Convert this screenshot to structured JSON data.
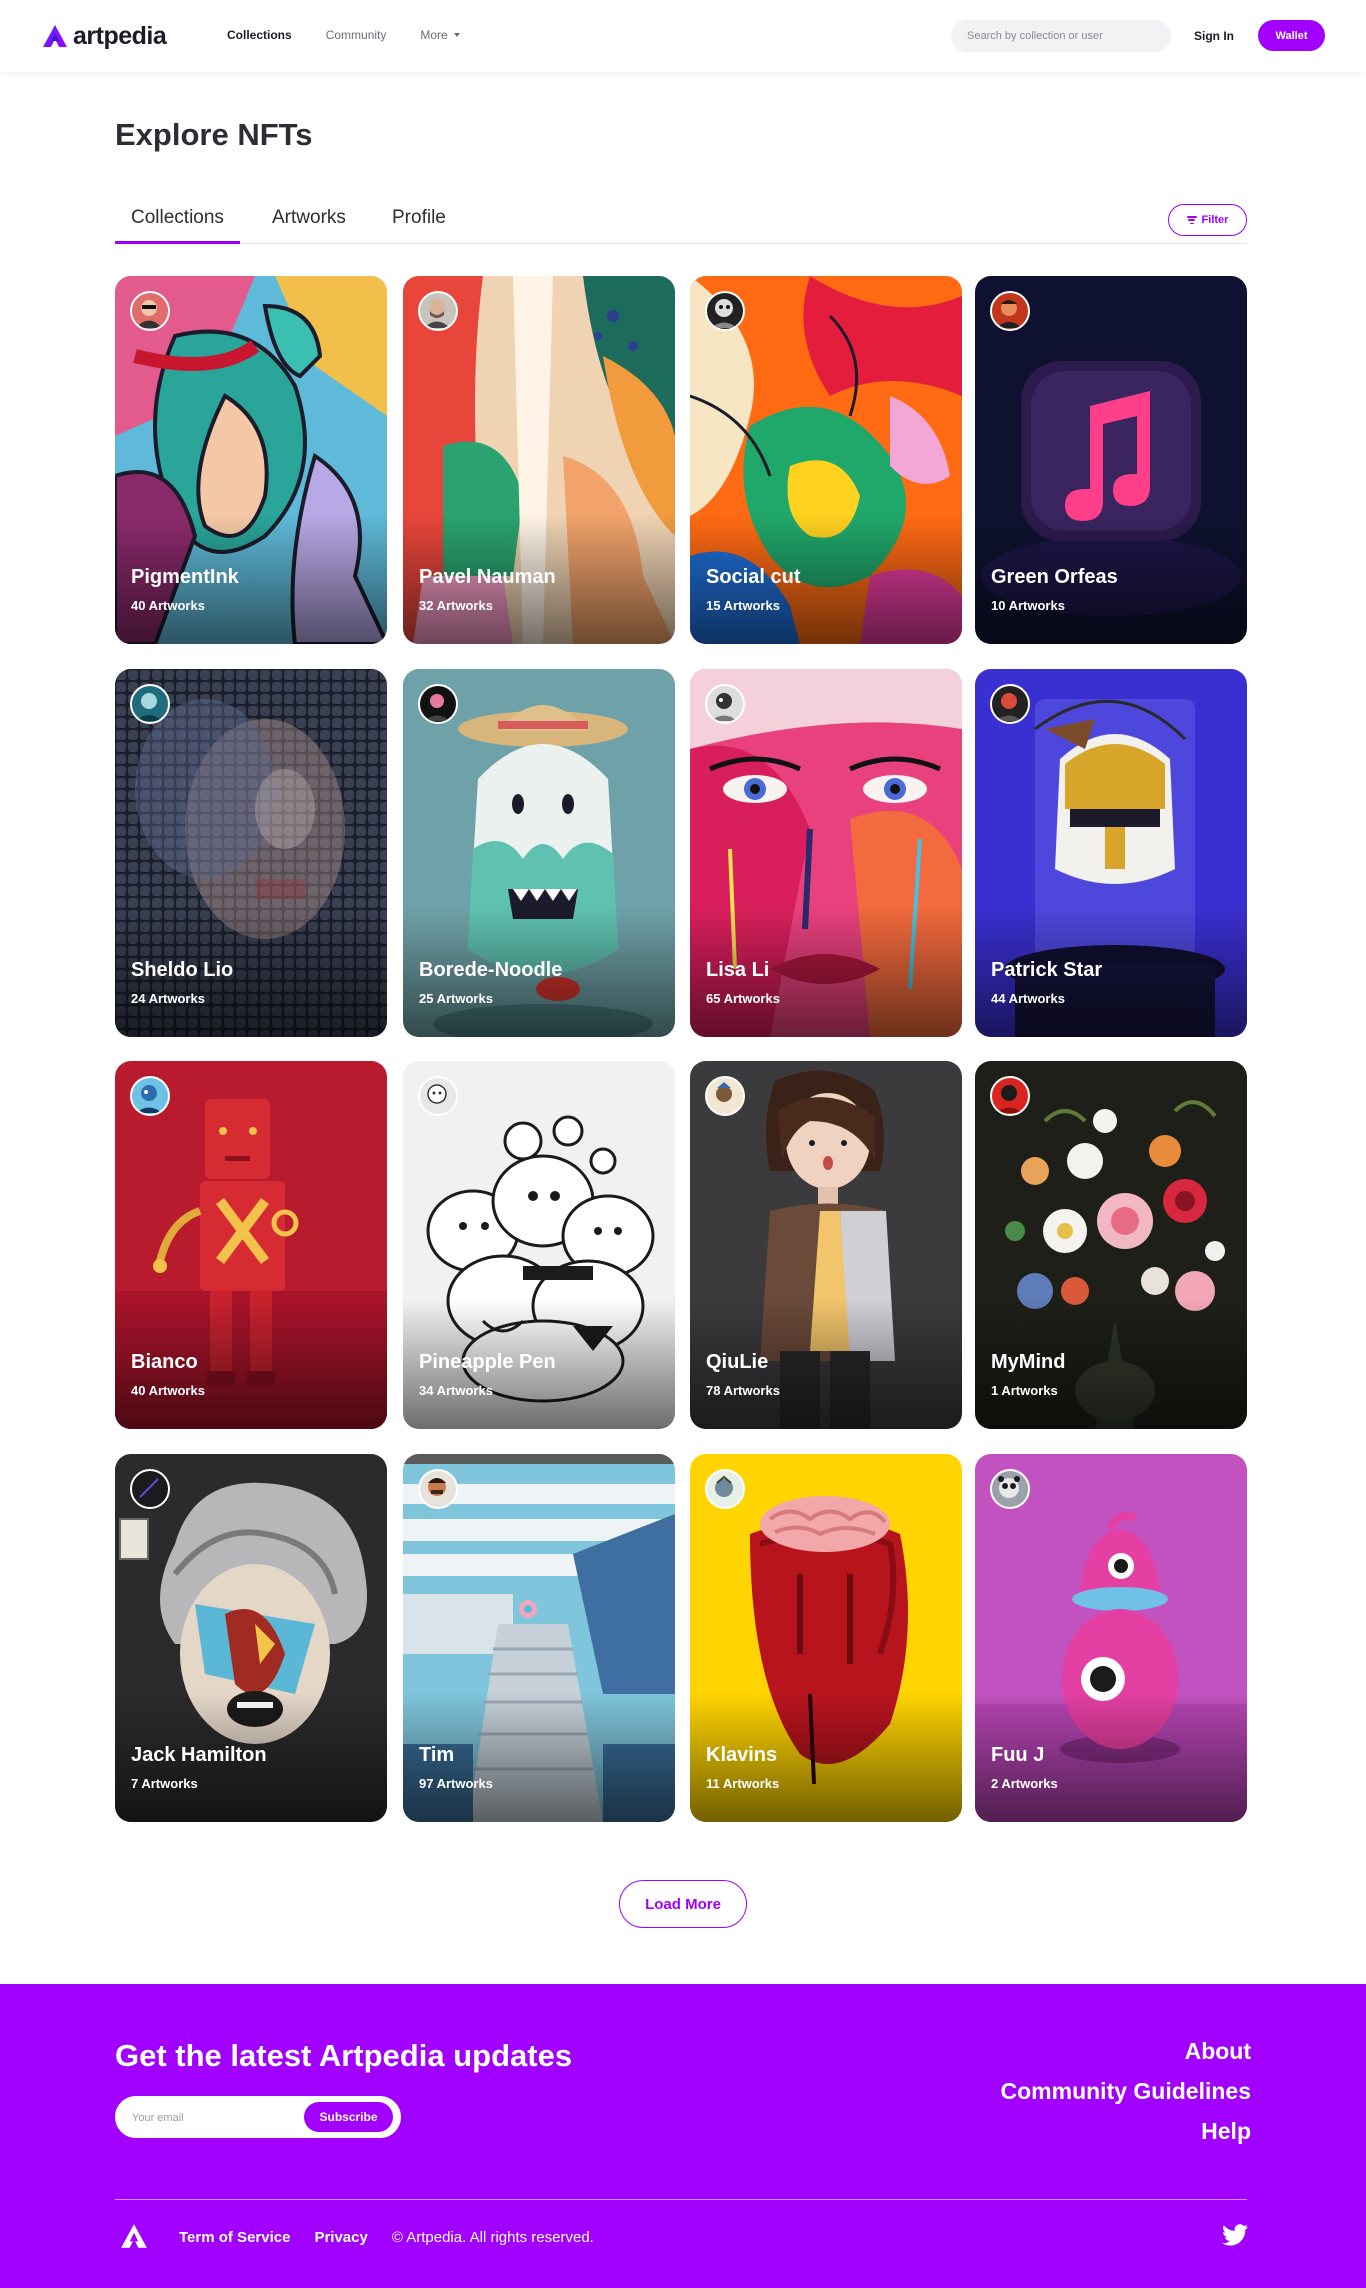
{
  "nav": {
    "brand": "artpedia",
    "links": [
      {
        "label": "Collections",
        "active": true
      },
      {
        "label": "Community",
        "active": false
      },
      {
        "label": "More",
        "active": false
      }
    ],
    "search_placeholder": "Search by collection or user",
    "signin_label": "Sign In",
    "wallet_label": "Wallet"
  },
  "page": {
    "title": "Explore NFTs",
    "tabs": [
      "Collections",
      "Artworks",
      "Profile"
    ],
    "active_tab": "Collections",
    "filter_label": "Filter"
  },
  "collections": [
    {
      "name": "PigmentInk",
      "count": "40 Artworks"
    },
    {
      "name": "Pavel Nauman",
      "count": "32 Artworks"
    },
    {
      "name": "Social cut",
      "count": "15 Artworks"
    },
    {
      "name": "Green Orfeas",
      "count": "10 Artworks"
    },
    {
      "name": "Sheldo Lio",
      "count": "24 Artworks"
    },
    {
      "name": "Borede-Noodle",
      "count": "25 Artworks"
    },
    {
      "name": "Lisa Li",
      "count": "65 Artworks"
    },
    {
      "name": "Patrick Star",
      "count": "44 Artworks"
    },
    {
      "name": "Bianco",
      "count": "40 Artworks"
    },
    {
      "name": "Pineapple Pen",
      "count": "34 Artworks"
    },
    {
      "name": "QiuLie",
      "count": "78 Artworks"
    },
    {
      "name": "MyMind",
      "count": "1 Artworks"
    },
    {
      "name": "Jack Hamilton",
      "count": "7 Artworks"
    },
    {
      "name": "Tim",
      "count": "97 Artworks"
    },
    {
      "name": "Klavins",
      "count": "11 Artworks"
    },
    {
      "name": "Fuu J",
      "count": "2 Artworks"
    }
  ],
  "load_more_label": "Load More",
  "footer": {
    "heading": "Get the latest Artpedia updates",
    "email_placeholder": "Your email",
    "subscribe_label": "Subscribe",
    "links": [
      "About",
      "Community Guidelines",
      "Help"
    ],
    "terms_label": "Term of Service",
    "privacy_label": "Privacy",
    "copyright": "© Artpedia. All rights reserved."
  },
  "colors": {
    "accent": "#a100ff",
    "text_dark": "#2d2d36",
    "search_bg": "#f2f2f4"
  },
  "icons": [
    "artpedia-logo-icon",
    "caret-down-icon",
    "filter-icon",
    "twitter-icon"
  ]
}
